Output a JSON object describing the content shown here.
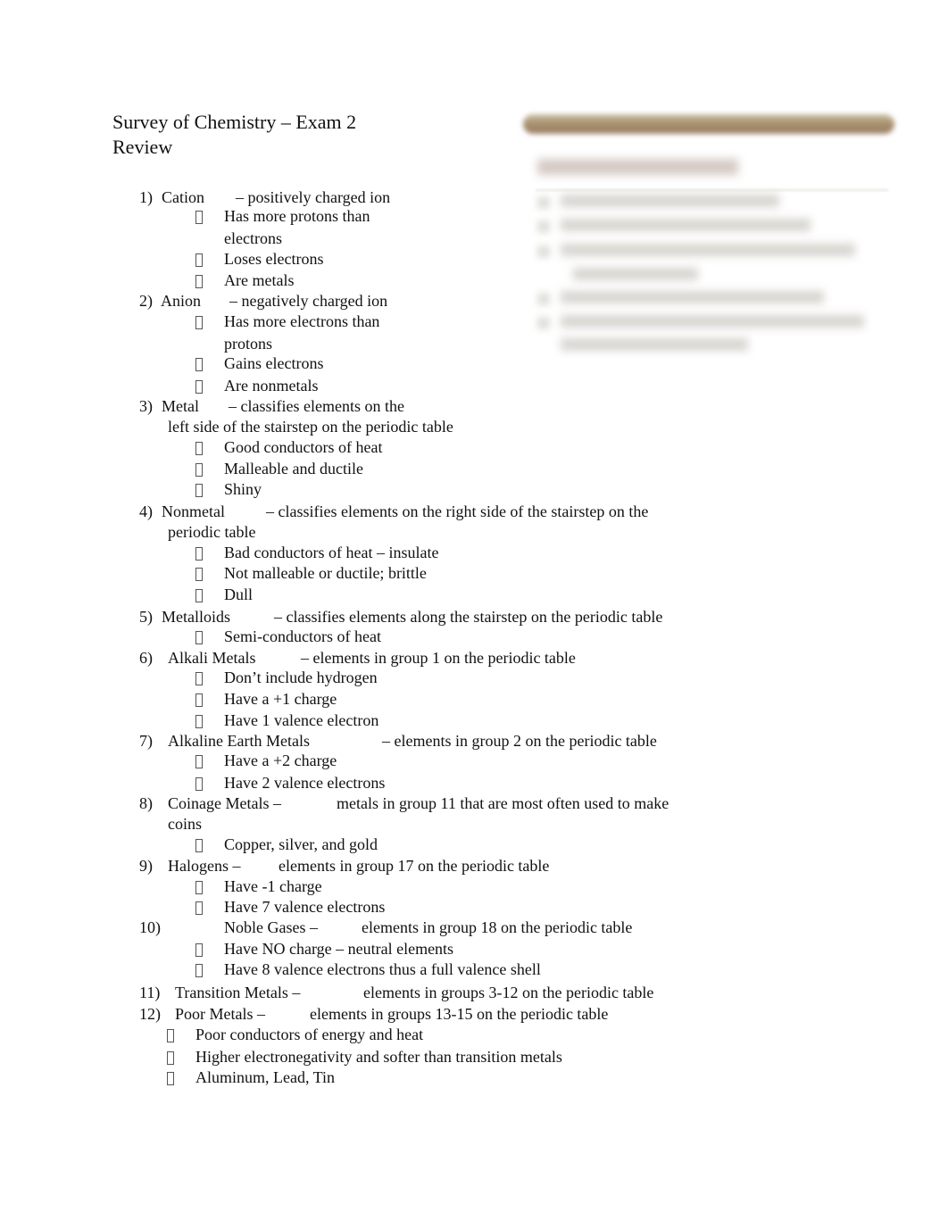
{
  "document": {
    "title_line1": "Survey of Chemistry – Exam 2",
    "title_line2": "Review",
    "bullet_icon": "square-bullet-icon",
    "items": [
      {
        "num": "1)",
        "term": "Cation",
        "def": "– positively charged ion",
        "bullets": [
          "Has more protons than",
          "electrons",
          "Loses electrons",
          "Are metals"
        ]
      },
      {
        "num": "2)",
        "term": "Anion",
        "def": "– negatively charged ion",
        "bullets": [
          "Has more electrons than",
          "protons",
          "Gains electrons",
          "Are nonmetals"
        ]
      },
      {
        "num": "3)",
        "term": "Metal",
        "def": "– classifies elements on the",
        "def2": "left side of the stairstep on the periodic table",
        "bullets": [
          "Good conductors of heat",
          "Malleable and ductile",
          "Shiny"
        ]
      },
      {
        "num": "4)",
        "term": "Nonmetal",
        "def": "– classifies elements on the right side of the stairstep on the",
        "def2": "periodic table",
        "bullets": [
          "Bad conductors of heat – insulate",
          "Not malleable or ductile; brittle",
          "Dull"
        ]
      },
      {
        "num": "5)",
        "term": "Metalloids",
        "def": "– classifies elements along the stairstep on the periodic table",
        "bullets": [
          "Semi-conductors of heat"
        ]
      },
      {
        "num": "6)",
        "term": "Alkali Metals",
        "def": "– elements in group 1 on the periodic table",
        "bullets": [
          "Don’t include hydrogen",
          "Have a +1 charge",
          "Have 1 valence electron"
        ]
      },
      {
        "num": "7)",
        "term": "Alkaline Earth Metals",
        "def": "– elements in group 2 on the periodic table",
        "bullets": [
          "Have a +2 charge",
          "Have 2 valence electrons"
        ]
      },
      {
        "num": "8)",
        "term": "Coinage Metals –",
        "def": "metals in group 11 that are most often used to make",
        "def2": "coins",
        "bullets": [
          "Copper, silver, and gold"
        ]
      },
      {
        "num": "9)",
        "term": "Halogens –",
        "def": "elements in group 17 on the periodic table",
        "bullets": [
          "Have -1 charge",
          "Have 7 valence electrons"
        ]
      },
      {
        "num": "10)",
        "term": "Noble Gases –",
        "def": "elements in group 18 on the periodic table",
        "bullets": [
          "Have NO charge – neutral elements",
          "Have 8 valence electrons thus a full valence shell"
        ]
      },
      {
        "num": "11)",
        "term": "Transition Metals –",
        "def": "elements in groups 3-12 on the periodic table",
        "bullets": []
      },
      {
        "num": "12)",
        "term": "Poor Metals –",
        "def": "elements in groups 13-15 on the periodic table",
        "bullets": [
          "Poor conductors of energy and heat",
          "Higher electronegativity and softer than transition metals",
          "Aluminum, Lead, Tin"
        ]
      }
    ]
  },
  "embedded_image": {
    "description": "blurred slide thumbnail",
    "accent_color": "#a48b6a"
  }
}
